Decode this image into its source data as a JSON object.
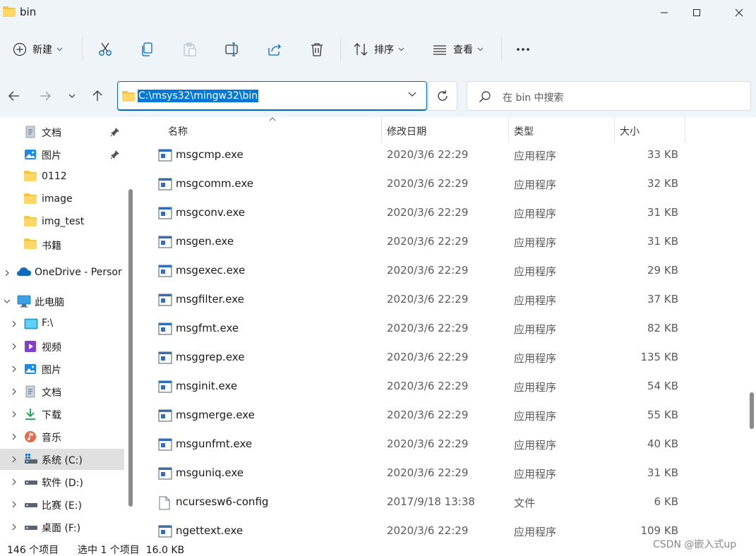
{
  "window": {
    "title": "bin"
  },
  "toolbar": {
    "new_label": "新建",
    "sort_label": "排序",
    "view_label": "查看"
  },
  "address": {
    "path": "C:\\msys32\\mingw32\\bin"
  },
  "search": {
    "placeholder": "在 bin 中搜索"
  },
  "sidebar": {
    "items": [
      {
        "label": "文档",
        "icon": "document-icon",
        "pinned": true,
        "indent": 1
      },
      {
        "label": "图片",
        "icon": "pictures-icon",
        "pinned": true,
        "indent": 1
      },
      {
        "label": "0112",
        "icon": "folder-icon",
        "indent": 1
      },
      {
        "label": "image",
        "icon": "folder-icon",
        "indent": 1
      },
      {
        "label": "img_test",
        "icon": "folder-icon",
        "indent": 1
      },
      {
        "label": "书籍",
        "icon": "folder-icon",
        "indent": 1
      },
      {
        "label": "OneDrive - Persor",
        "icon": "onedrive-icon",
        "indent": 0,
        "expander": "collapsed"
      },
      {
        "label": "此电脑",
        "icon": "computer-icon",
        "indent": 0,
        "expander": "expanded"
      },
      {
        "label": "F:\\",
        "icon": "drive-f-icon",
        "indent": 1,
        "expander": "collapsed"
      },
      {
        "label": "视频",
        "icon": "videos-icon",
        "indent": 1,
        "expander": "collapsed"
      },
      {
        "label": "图片",
        "icon": "pictures-icon",
        "indent": 1,
        "expander": "collapsed"
      },
      {
        "label": "文档",
        "icon": "document-icon",
        "indent": 1,
        "expander": "collapsed"
      },
      {
        "label": "下载",
        "icon": "download-icon",
        "indent": 1,
        "expander": "collapsed"
      },
      {
        "label": "音乐",
        "icon": "music-icon",
        "indent": 1,
        "expander": "collapsed"
      },
      {
        "label": "系统 (C:)",
        "icon": "system-drive-icon",
        "indent": 1,
        "expander": "collapsed",
        "selected": true
      },
      {
        "label": "软件 (D:)",
        "icon": "drive-icon",
        "indent": 1,
        "expander": "collapsed"
      },
      {
        "label": "比赛 (E:)",
        "icon": "drive-icon",
        "indent": 1,
        "expander": "collapsed"
      },
      {
        "label": "桌面 (F:)",
        "icon": "drive-icon",
        "indent": 1,
        "expander": "collapsed"
      }
    ]
  },
  "columns": {
    "name": "名称",
    "date": "修改日期",
    "type": "类型",
    "size": "大小"
  },
  "files": [
    {
      "name": "msgcmp.exe",
      "date": "2020/3/6 22:29",
      "type": "应用程序",
      "size": "33 KB",
      "icon": "exe-icon"
    },
    {
      "name": "msgcomm.exe",
      "date": "2020/3/6 22:29",
      "type": "应用程序",
      "size": "32 KB",
      "icon": "exe-icon"
    },
    {
      "name": "msgconv.exe",
      "date": "2020/3/6 22:29",
      "type": "应用程序",
      "size": "31 KB",
      "icon": "exe-icon"
    },
    {
      "name": "msgen.exe",
      "date": "2020/3/6 22:29",
      "type": "应用程序",
      "size": "31 KB",
      "icon": "exe-icon"
    },
    {
      "name": "msgexec.exe",
      "date": "2020/3/6 22:29",
      "type": "应用程序",
      "size": "29 KB",
      "icon": "exe-icon"
    },
    {
      "name": "msgfilter.exe",
      "date": "2020/3/6 22:29",
      "type": "应用程序",
      "size": "37 KB",
      "icon": "exe-icon"
    },
    {
      "name": "msgfmt.exe",
      "date": "2020/3/6 22:29",
      "type": "应用程序",
      "size": "82 KB",
      "icon": "exe-icon"
    },
    {
      "name": "msggrep.exe",
      "date": "2020/3/6 22:29",
      "type": "应用程序",
      "size": "135 KB",
      "icon": "exe-icon"
    },
    {
      "name": "msginit.exe",
      "date": "2020/3/6 22:29",
      "type": "应用程序",
      "size": "54 KB",
      "icon": "exe-icon"
    },
    {
      "name": "msgmerge.exe",
      "date": "2020/3/6 22:29",
      "type": "应用程序",
      "size": "55 KB",
      "icon": "exe-icon"
    },
    {
      "name": "msgunfmt.exe",
      "date": "2020/3/6 22:29",
      "type": "应用程序",
      "size": "40 KB",
      "icon": "exe-icon"
    },
    {
      "name": "msguniq.exe",
      "date": "2020/3/6 22:29",
      "type": "应用程序",
      "size": "31 KB",
      "icon": "exe-icon"
    },
    {
      "name": "ncursesw6-config",
      "date": "2017/9/18 13:38",
      "type": "文件",
      "size": "6 KB",
      "icon": "file-icon"
    },
    {
      "name": "ngettext.exe",
      "date": "2020/3/6 22:29",
      "type": "应用程序",
      "size": "109 KB",
      "icon": "exe-icon"
    }
  ],
  "status": {
    "item_count": "146 个项目",
    "selection": "选中 1 个项目  16.0 KB"
  },
  "watermark": "CSDN @嵌入式up",
  "colors": {
    "accent": "#0067c0",
    "chrome_bg": "#eff4f9",
    "selection_bg": "#e0e0e0",
    "folder": "#f6c343"
  }
}
